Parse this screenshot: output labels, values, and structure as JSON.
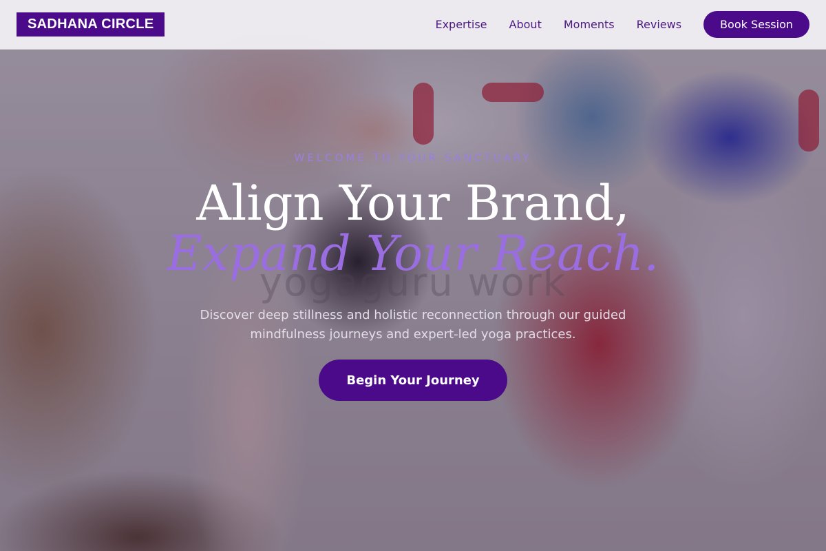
{
  "nav": {
    "brand": "SADHANA CIRCLE",
    "links": [
      "Expertise",
      "About",
      "Moments",
      "Reviews"
    ],
    "cta": "Book Session"
  },
  "hero": {
    "eyebrow": "WELCOME TO YOUR SANCTUARY",
    "headline": "Align Your Brand,",
    "headline_accent": "Expand Your Reach.",
    "watermark": "yogaguru work",
    "subtext": "Discover deep stillness and holistic reconnection through our guided mindfulness journeys and expert-led yoga practices.",
    "cta": "Begin Your Journey"
  },
  "colors": {
    "brand": "#4b0a8a",
    "accent": "#9a6ee0",
    "nav_text": "#4b1a80"
  }
}
